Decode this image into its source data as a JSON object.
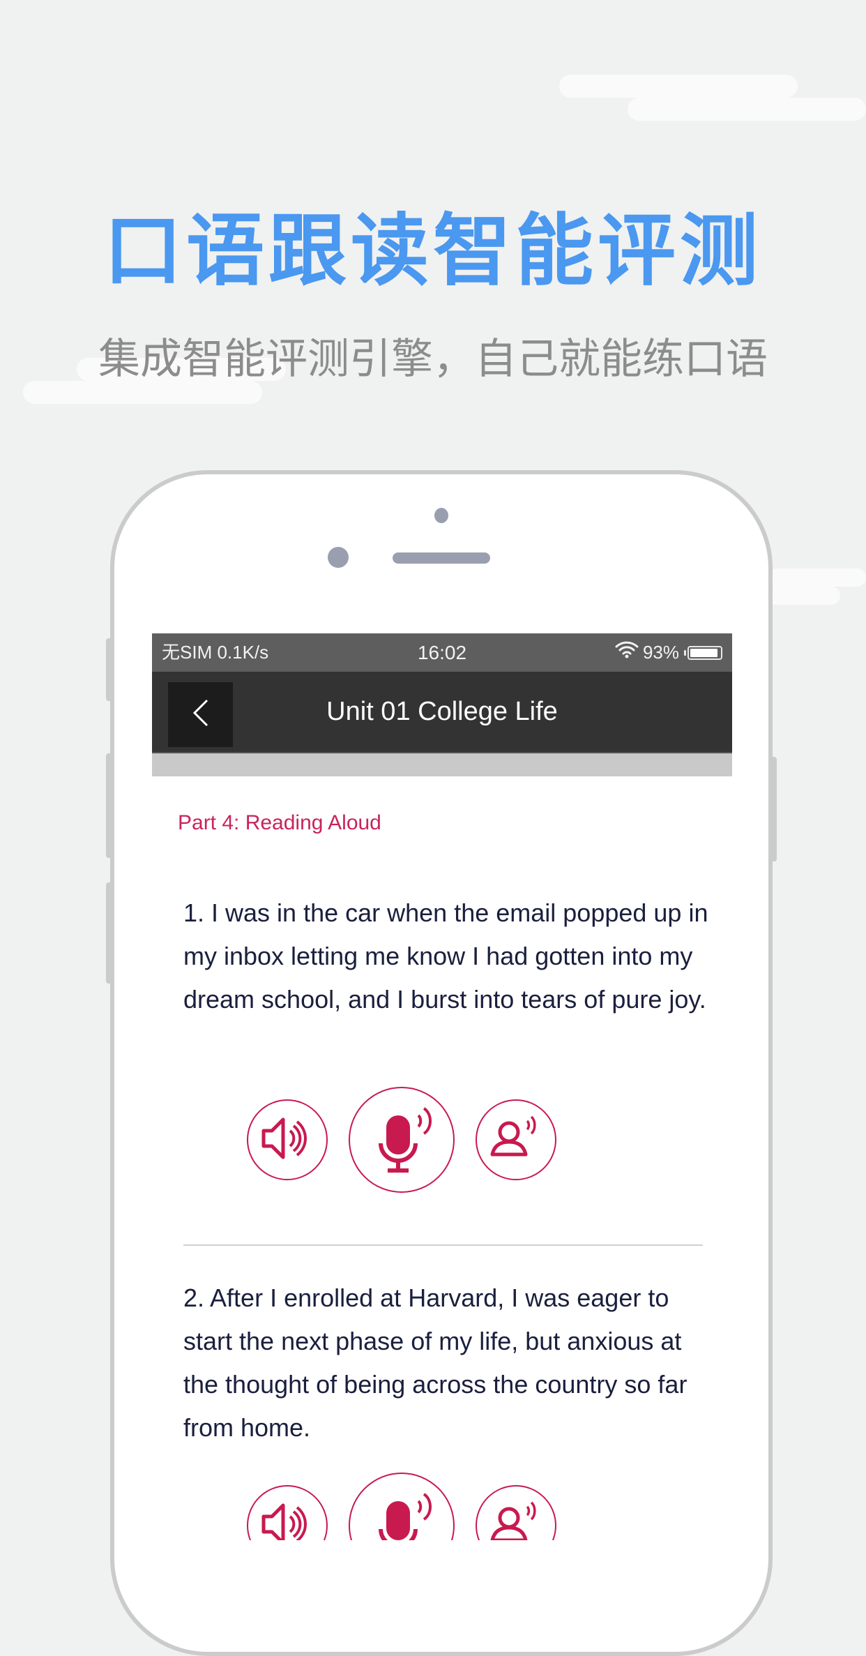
{
  "hero": {
    "title": "口语跟读智能评测",
    "subtitle": "集成智能评测引擎，自己就能练口语"
  },
  "status_bar": {
    "carrier": "无SIM 0.1K/s",
    "time": "16:02",
    "battery_text": "93%",
    "battery_level": 0.93,
    "icons": [
      "wifi-icon",
      "battery-icon"
    ]
  },
  "nav": {
    "back_icon": "chevron-left-icon",
    "title": "Unit 01 College Life"
  },
  "content": {
    "section_label": "Part 4: Reading Aloud",
    "items": [
      {
        "text": "1. I was in the car when the email popped up in my inbox letting me know I had gotten into my dream school, and I burst into tears of pure joy.",
        "buttons": [
          "play-original",
          "record",
          "play-recording"
        ]
      },
      {
        "text": "2. After I enrolled at Harvard, I was eager to start the next phase of my life, but anxious at the thought of being across the country so far from home.",
        "buttons": [
          "play-original",
          "record",
          "play-recording"
        ]
      }
    ]
  },
  "colors": {
    "accent": "#c81a4f",
    "hero_blue": "#4a98ef",
    "subtitle_gray": "#8c8c8c",
    "navbar": "#333333",
    "statusbar": "#5e5e5e"
  }
}
